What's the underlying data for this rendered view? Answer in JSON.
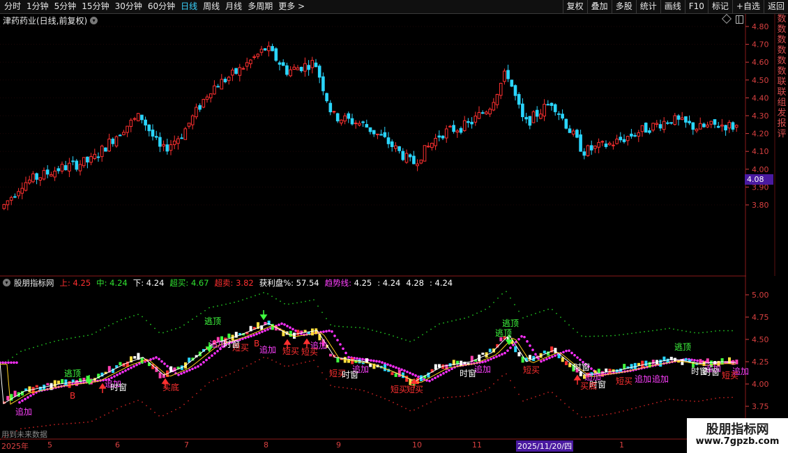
{
  "toolbar": {
    "periods": [
      "分时",
      "1分钟",
      "5分钟",
      "15分钟",
      "30分钟",
      "60分钟",
      "日线",
      "周线",
      "月线",
      "多周期",
      "更多 >"
    ],
    "active_period": "日线",
    "buttons": [
      "复权",
      "叠加",
      "多股",
      "统计",
      "画线",
      "F10",
      "标记",
      "+自选",
      "返回"
    ]
  },
  "main_chart": {
    "title": "津药药业(日线,前复权)",
    "price_marker": "4.08",
    "y_ticks": [
      "4.80",
      "4.70",
      "4.60",
      "4.50",
      "4.40",
      "4.30",
      "4.20",
      "4.10",
      "4.00",
      "3.90",
      "3.80"
    ],
    "right_strip_chars": [
      "数",
      "数",
      "数",
      "数",
      "数",
      "数",
      "联",
      "联",
      "组",
      "发",
      "报",
      "评"
    ]
  },
  "indicator": {
    "name": "股朋指标网",
    "values": [
      {
        "label": "上:",
        "value": "4.25",
        "color": "#ff3030"
      },
      {
        "label": "中:",
        "value": "4.24",
        "color": "#30e030"
      },
      {
        "label": "下:",
        "value": "4.24",
        "color": "#ffffff"
      },
      {
        "label": "超买:",
        "value": "4.67",
        "color": "#30e030"
      },
      {
        "label": "超卖:",
        "value": "3.82",
        "color": "#ff3030"
      },
      {
        "label": "获利盘%:",
        "value": "57.54",
        "color": "#ffffff"
      },
      {
        "label": "趋势线:",
        "value": "4.25",
        "color": "#ff40ff"
      },
      {
        "label": ":",
        "value": "4.24",
        "color": "#ffffff"
      },
      {
        "label": "",
        "value": "4.28",
        "color": "#3050ff"
      },
      {
        "label": ":",
        "value": "4.24",
        "color": "#ffffff"
      }
    ],
    "y_ticks": [
      "5.00",
      "4.75",
      "4.50",
      "4.25",
      "4.00",
      "3.75"
    ],
    "signals": [
      {
        "text": "逃顶",
        "color": "#40ff40"
      },
      {
        "text": "逃顶",
        "color": "#40ff40"
      },
      {
        "text": "逃顶",
        "color": "#40ff40"
      },
      {
        "text": "逃顶",
        "color": "#40ff40"
      },
      {
        "text": "逃顶",
        "color": "#40ff40"
      },
      {
        "text": "追加",
        "color": "#ff40ff"
      },
      {
        "text": "追加",
        "color": "#ff40ff"
      },
      {
        "text": "追加",
        "color": "#ff40ff"
      },
      {
        "text": "追加",
        "color": "#ff40ff"
      },
      {
        "text": "追加",
        "color": "#ff40ff"
      },
      {
        "text": "追加",
        "color": "#ff40ff"
      },
      {
        "text": "追加",
        "color": "#ff40ff"
      },
      {
        "text": "追加",
        "color": "#ff40ff"
      },
      {
        "text": "追加",
        "color": "#ff40ff"
      },
      {
        "text": "追加",
        "color": "#ff40ff"
      },
      {
        "text": "追加",
        "color": "#ff40ff"
      },
      {
        "text": "追加",
        "color": "#ff40ff"
      },
      {
        "text": "短买",
        "color": "#ff3030"
      },
      {
        "text": "短买",
        "color": "#ff3030"
      },
      {
        "text": "短买",
        "color": "#ff3030"
      },
      {
        "text": "短买",
        "color": "#ff3030"
      },
      {
        "text": "短买",
        "color": "#ff3030"
      },
      {
        "text": "短买",
        "color": "#ff3030"
      },
      {
        "text": "短买",
        "color": "#ff3030"
      },
      {
        "text": "短买",
        "color": "#ff3030"
      },
      {
        "text": "短买",
        "color": "#ff3030"
      },
      {
        "text": "时窗",
        "color": "#ffffff"
      },
      {
        "text": "时窗",
        "color": "#ffffff"
      },
      {
        "text": "时窗",
        "color": "#ffffff"
      },
      {
        "text": "时窗",
        "color": "#ffffff"
      },
      {
        "text": "时窗",
        "color": "#ffffff"
      },
      {
        "text": "时窗",
        "color": "#ffffff"
      },
      {
        "text": "时窗",
        "color": "#ffffff"
      },
      {
        "text": "时窗",
        "color": "#ffffff"
      },
      {
        "text": "买底",
        "color": "#ff3030"
      },
      {
        "text": "买底",
        "color": "#ff3030"
      },
      {
        "text": "B",
        "color": "#ff3030"
      },
      {
        "text": "B",
        "color": "#ff3030"
      }
    ]
  },
  "date_axis": [
    "2025年",
    "5",
    "6",
    "7",
    "8",
    "9",
    "10",
    "11",
    "2025/11/20/四",
    "1"
  ],
  "future_note": "用到未来数据",
  "watermark": {
    "title": "股朋指标网",
    "url": "www.7gpzb.com"
  },
  "colors": {
    "up": "#ff3030",
    "down": "#2ad6ff",
    "grid": "#5a1010",
    "axis": "#d84040"
  }
}
